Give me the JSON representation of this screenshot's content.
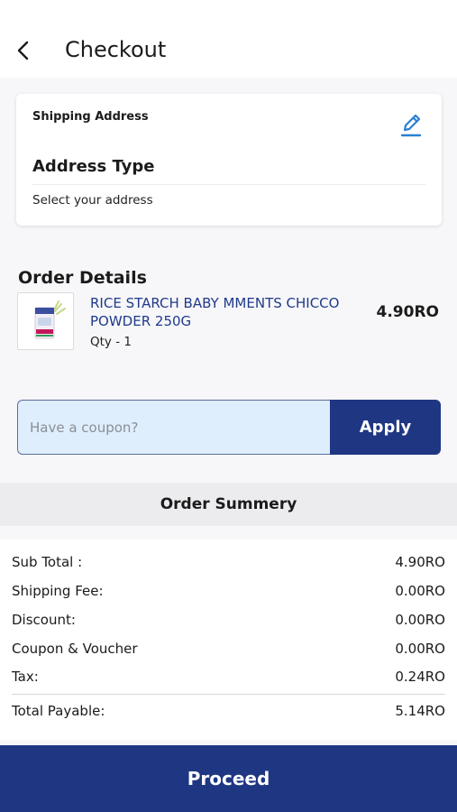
{
  "header": {
    "title": "Checkout",
    "back_icon": "back-arrow-icon"
  },
  "shipping": {
    "label": "Shipping Address",
    "address_type": "Address Type",
    "subtitle": "Select your address",
    "edit_icon": "pencil-icon"
  },
  "order_details": {
    "title": "Order Details",
    "items": [
      {
        "name": "RICE STARCH BABY MMENTS CHICCO POWDER 250G",
        "qty": "Qty - 1",
        "price": "4.90RO"
      }
    ]
  },
  "coupon": {
    "placeholder": "Have a coupon?",
    "apply_label": "Apply"
  },
  "summary": {
    "title": "Order Summery",
    "rows": [
      {
        "label": "Sub Total :",
        "value": "4.90RO"
      },
      {
        "label": "Shipping Fee:",
        "value": "0.00RO"
      },
      {
        "label": "Discount:",
        "value": "0.00RO"
      },
      {
        "label": "Coupon & Voucher",
        "value": "0.00RO"
      },
      {
        "label": "Tax:",
        "value": "0.24RO"
      }
    ],
    "total": {
      "label": "Total Payable:",
      "value": "5.14RO"
    }
  },
  "footer": {
    "proceed_label": "Proceed"
  },
  "colors": {
    "primary": "#1f3683",
    "link": "#203a8a",
    "coupon_bg": "#dfeefc",
    "edit_icon": "#2a7fd4"
  }
}
